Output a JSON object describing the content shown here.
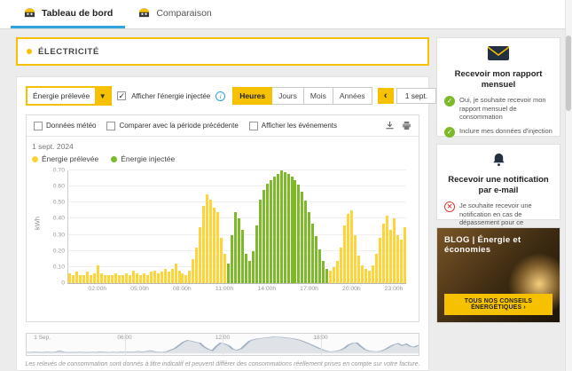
{
  "tabs": [
    {
      "label": "Tableau de bord",
      "active": true
    },
    {
      "label": "Comparaison",
      "active": false
    }
  ],
  "electricity": {
    "title": "ÉLECTRICITÉ"
  },
  "controls": {
    "energy_select": {
      "value": "Énergie prélevée"
    },
    "show_injected": {
      "label": "Afficher l'énergie injectée",
      "checked": true
    },
    "info_icon": "i",
    "periods": [
      {
        "label": "Heures",
        "active": true
      },
      {
        "label": "Jours",
        "active": false
      },
      {
        "label": "Mois",
        "active": false
      },
      {
        "label": "Années",
        "active": false
      }
    ],
    "date_nav": {
      "prev": "‹",
      "label": "1 sept.",
      "next": "›"
    }
  },
  "chart_card": {
    "options": [
      {
        "label": "Données météo",
        "checked": false
      },
      {
        "label": "Comparer avec la période précédente",
        "checked": false
      },
      {
        "label": "Afficher les événements",
        "checked": false
      }
    ],
    "icons": [
      "download-icon",
      "print-icon"
    ],
    "date_label": "1 sept. 2024",
    "legend": [
      {
        "label": "Énergie prélevée",
        "color": "#fdd53a"
      },
      {
        "label": "Énergie injectée",
        "color": "#7db928"
      }
    ]
  },
  "chart_data": {
    "type": "bar",
    "title": "1 sept. 2024",
    "ylabel": "kWh",
    "ylim": [
      0,
      0.7
    ],
    "yticks": [
      0,
      0.1,
      0.2,
      0.3,
      0.4,
      0.5,
      0.6,
      0.7
    ],
    "interval_minutes": 15,
    "x_tick_labels": [
      "02:00h",
      "05:00h",
      "08:00h",
      "11:00h",
      "14:00h",
      "17:00h",
      "20:00h",
      "23:00h"
    ],
    "x_tick_slots": [
      8,
      20,
      32,
      44,
      56,
      68,
      80,
      92
    ],
    "grid": true,
    "legend_position": "top-left",
    "series": [
      {
        "name": "Énergie prélevée",
        "color": "#fdd53a",
        "values": [
          0.06,
          0.05,
          0.07,
          0.05,
          0.05,
          0.07,
          0.05,
          0.06,
          0.11,
          0.06,
          0.05,
          0.05,
          0.05,
          0.06,
          0.05,
          0.05,
          0.06,
          0.05,
          0.08,
          0.06,
          0.05,
          0.06,
          0.05,
          0.07,
          0.08,
          0.06,
          0.07,
          0.09,
          0.07,
          0.09,
          0.12,
          0.08,
          0.06,
          0.05,
          0.08,
          0.15,
          0.22,
          0.35,
          0.48,
          0.55,
          0.52,
          0.47,
          0.44,
          0.28,
          0.18,
          0.08,
          0.04,
          0.03,
          0.03,
          0.02,
          0.03,
          0.02,
          0.02,
          0.02,
          0.02,
          0.02,
          0.02,
          0.02,
          0.02,
          0.02,
          0.02,
          0.02,
          0.02,
          0.02,
          0.02,
          0.02,
          0.02,
          0.02,
          0.02,
          0.03,
          0.03,
          0.04,
          0.05,
          0.06,
          0.08,
          0.1,
          0.14,
          0.22,
          0.36,
          0.43,
          0.45,
          0.3,
          0.17,
          0.11,
          0.09,
          0.08,
          0.11,
          0.18,
          0.28,
          0.37,
          0.42,
          0.33,
          0.4,
          0.3,
          0.27,
          0.35
        ]
      },
      {
        "name": "Énergie injectée",
        "color": "#7db928",
        "values": [
          0,
          0,
          0,
          0,
          0,
          0,
          0,
          0,
          0,
          0,
          0,
          0,
          0,
          0,
          0,
          0,
          0,
          0,
          0,
          0,
          0,
          0,
          0,
          0,
          0,
          0,
          0,
          0,
          0,
          0,
          0,
          0,
          0,
          0,
          0,
          0,
          0,
          0,
          0,
          0,
          0,
          0,
          0,
          0,
          0,
          0.12,
          0.3,
          0.44,
          0.4,
          0.33,
          0.18,
          0.14,
          0.2,
          0.36,
          0.52,
          0.58,
          0.62,
          0.64,
          0.66,
          0.68,
          0.7,
          0.69,
          0.68,
          0.66,
          0.64,
          0.61,
          0.57,
          0.51,
          0.44,
          0.37,
          0.29,
          0.21,
          0.14,
          0.09,
          0.05,
          0.03,
          0,
          0,
          0,
          0,
          0,
          0,
          0,
          0,
          0,
          0,
          0,
          0,
          0,
          0,
          0,
          0,
          0,
          0,
          0,
          0
        ]
      }
    ]
  },
  "minimap": {
    "labels": [
      "1 Sep.",
      "06:00",
      "12:00",
      "18:00"
    ]
  },
  "footnote": "Les relevés de consommation sont donnés à titre indicatif et peuvent différer des consommations réellement prises en compte sur votre facture.",
  "sidebar": {
    "report_card": {
      "title": "Recevoir mon rapport mensuel",
      "items": [
        {
          "label": "Oui, je souhaite recevoir mon rapport mensuel de consommation",
          "status": "on"
        },
        {
          "label": "Inclure mes données d'injection",
          "status": "on"
        }
      ]
    },
    "notification_card": {
      "title": "Recevoir une notification par e-mail",
      "items": [
        {
          "label": "Je souhaite recevoir une notification en cas de dépassement pour ce compteur",
          "status": "off"
        }
      ]
    },
    "blog_card": {
      "title": "BLOG | Énergie et économies",
      "button": "TOUS NOS CONSEILS ÉNERGÉTIQUES ›"
    }
  },
  "colors": {
    "accent": "#f6c100",
    "tab_underline": "#2fa3dc",
    "on": "#7db928",
    "off": "#e03c31"
  }
}
